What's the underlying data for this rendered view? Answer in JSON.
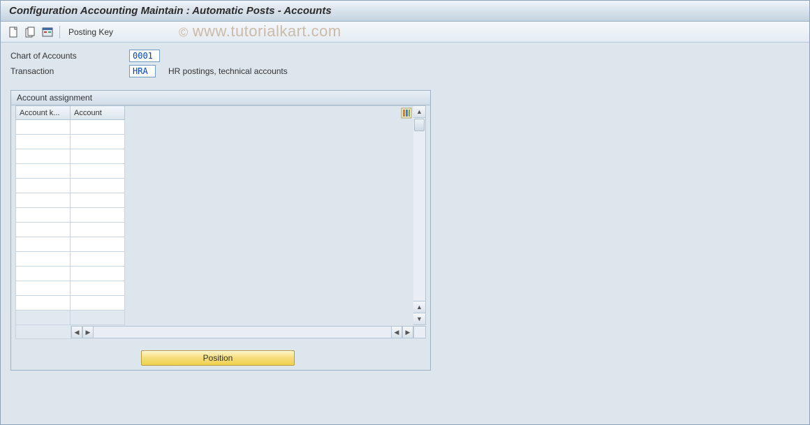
{
  "titlebar": {
    "title": "Configuration Accounting Maintain : Automatic Posts - Accounts"
  },
  "toolbar": {
    "posting_key_label": "Posting Key"
  },
  "fields": {
    "chart_of_accounts_label": "Chart of Accounts",
    "chart_of_accounts_value": "0001",
    "transaction_label": "Transaction",
    "transaction_value": "HRA",
    "transaction_desc": "HR postings, technical accounts"
  },
  "panel": {
    "title": "Account assignment",
    "columns": {
      "col1": "Account k...",
      "col2": "Account"
    }
  },
  "buttons": {
    "position": "Position"
  },
  "watermark": {
    "text": "www.tutorialkart.com"
  }
}
